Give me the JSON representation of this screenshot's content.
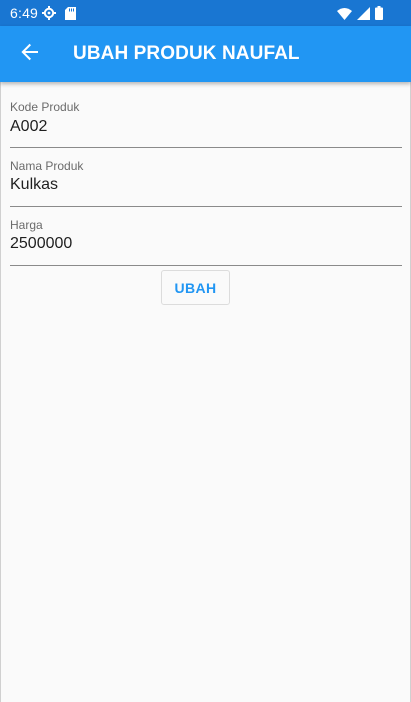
{
  "status_bar": {
    "time": "6:49",
    "icons": [
      "settings-gear-icon",
      "sd-card-icon",
      "wifi-icon",
      "signal-icon",
      "battery-icon"
    ],
    "background_color": "#1976d2"
  },
  "app_bar": {
    "title": "UBAH PRODUK NAUFAL",
    "back_icon": "arrow-back-icon",
    "background_color": "#2196f3"
  },
  "form": {
    "fields": [
      {
        "label": "Kode Produk",
        "value": "A002"
      },
      {
        "label": "Nama Produk",
        "value": "Kulkas"
      },
      {
        "label": "Harga",
        "value": "2500000"
      }
    ],
    "submit_label": "UBAH",
    "accent_color": "#2196f3"
  }
}
